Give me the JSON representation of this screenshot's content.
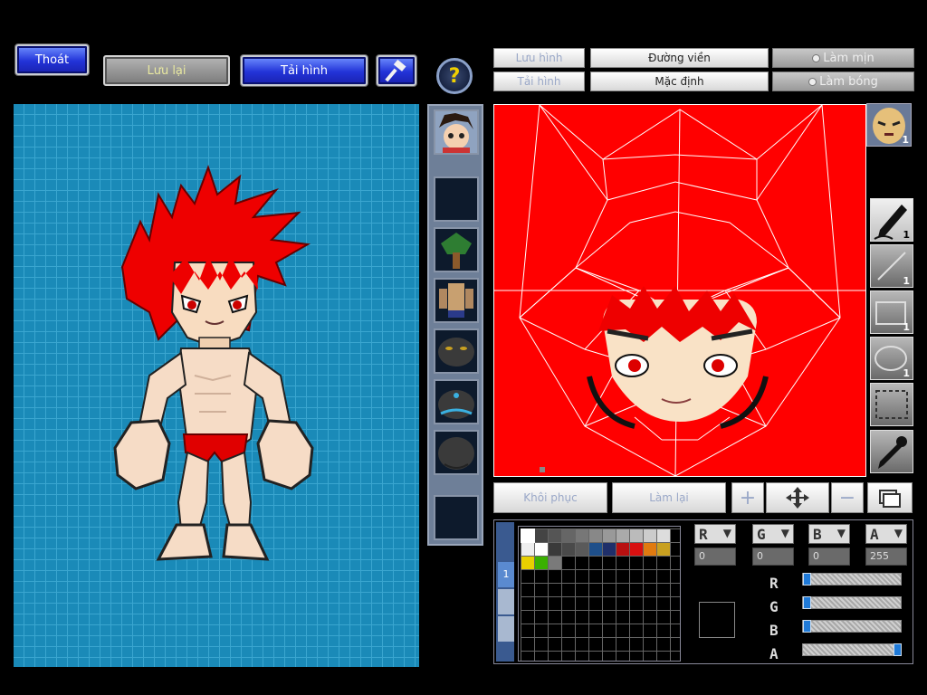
{
  "toolbar": {
    "exit_label": "Thoát",
    "save_label": "Lưu lại",
    "reload_label": "Tải hình",
    "help_icon": "help-icon",
    "hammer_icon": "hammer-icon"
  },
  "editor_toolbar": {
    "save_image": "Lưu hình",
    "load_image": "Tải hình",
    "outline": "Đường viền",
    "default": "Mặc định",
    "smooth": "Làm mịn",
    "shade": "Làm bóng"
  },
  "texture_slots": [
    {
      "name": "texture-slot-face-portrait"
    },
    {
      "name": "texture-slot-empty"
    },
    {
      "name": "texture-slot-tree"
    },
    {
      "name": "texture-slot-body"
    },
    {
      "name": "texture-slot-dark-face"
    },
    {
      "name": "texture-slot-dark-head"
    },
    {
      "name": "texture-slot-dark-back"
    },
    {
      "name": "texture-slot-empty"
    }
  ],
  "tools": [
    {
      "name": "pen-tool",
      "count": "1"
    },
    {
      "name": "line-tool",
      "count": "1"
    },
    {
      "name": "rectangle-tool",
      "count": "1"
    },
    {
      "name": "ellipse-tool",
      "count": "1"
    },
    {
      "name": "select-tool",
      "count": ""
    },
    {
      "name": "eyedropper-tool",
      "count": ""
    }
  ],
  "preview_badge": "1",
  "actions": {
    "restore": "Khôi phục",
    "redo": "Làm lại"
  },
  "palette": {
    "tab_label": "1",
    "colors_row1": [
      "#ffffff",
      "#444444",
      "#555555",
      "#666666",
      "#777777",
      "#888888",
      "#999999",
      "#aaaaaa",
      "#bbbbbb",
      "#cccccc",
      "#dddddd"
    ],
    "colors_row2": [
      "#eeeeee",
      "#ffffff",
      "#3a3a3a",
      "#4a4a4a",
      "#5a5a5a",
      "#1e4f8a",
      "#1f2f6a",
      "#b81010",
      "#d81010",
      "#e07a10",
      "#c8a020"
    ],
    "colors_row3": [
      "#e8d000",
      "#3ab000",
      "#7a7a7a"
    ]
  },
  "channels": {
    "r": {
      "label": "R",
      "value": "0",
      "level": 0.0
    },
    "g": {
      "label": "G",
      "value": "0",
      "level": 0.0
    },
    "b": {
      "label": "B",
      "value": "0",
      "level": 0.0
    },
    "a": {
      "label": "A",
      "value": "255",
      "level": 1.0
    }
  }
}
